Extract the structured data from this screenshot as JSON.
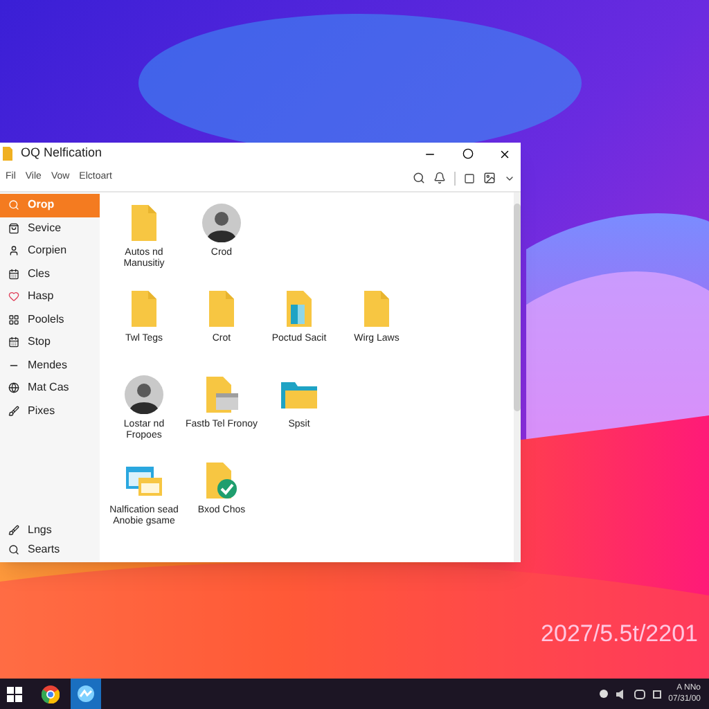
{
  "window": {
    "title": "OQ Nelfication",
    "menu": [
      "Fil",
      "Vile",
      "Vow",
      "Elctoart"
    ]
  },
  "sidebar": {
    "items": [
      {
        "label": "Orop",
        "selected": true
      },
      {
        "label": "Sevice",
        "selected": false
      },
      {
        "label": "Corpien",
        "selected": false
      },
      {
        "label": "Cles",
        "selected": false
      },
      {
        "label": "Hasp",
        "selected": false
      },
      {
        "label": "Poolels",
        "selected": false
      },
      {
        "label": "Stop",
        "selected": false
      },
      {
        "label": "Mendes",
        "selected": false
      },
      {
        "label": "Mat Cas",
        "selected": false
      },
      {
        "label": "Pixes",
        "selected": false
      }
    ],
    "bottom": [
      {
        "label": "Lngs"
      },
      {
        "label": "Searts"
      }
    ]
  },
  "items": [
    {
      "kind": "folder",
      "label": "Autos nd Manusitiy"
    },
    {
      "kind": "avatar",
      "label": "Crod"
    },
    {
      "kind": "blank"
    },
    {
      "kind": "blank"
    },
    {
      "kind": "folder",
      "label": "Twl Tegs"
    },
    {
      "kind": "folder",
      "label": "Crot"
    },
    {
      "kind": "doc-folder",
      "label": "Poctud Sacit"
    },
    {
      "kind": "folder",
      "label": "Wirg Laws"
    },
    {
      "kind": "avatar",
      "label": "Lostar nd Fropoes"
    },
    {
      "kind": "drive-folder",
      "label": "Fastb Tel Fronoy"
    },
    {
      "kind": "open-folder",
      "label": "Spsit"
    },
    {
      "kind": "blank"
    },
    {
      "kind": "window",
      "label": "Nalfication sead Anobie gsame"
    },
    {
      "kind": "badge-folder",
      "label": "Bxod Chos"
    }
  ],
  "desktop_text": "2027/5.5t/2201",
  "tray": {
    "time": "A NNo",
    "date": "07/31/00"
  }
}
